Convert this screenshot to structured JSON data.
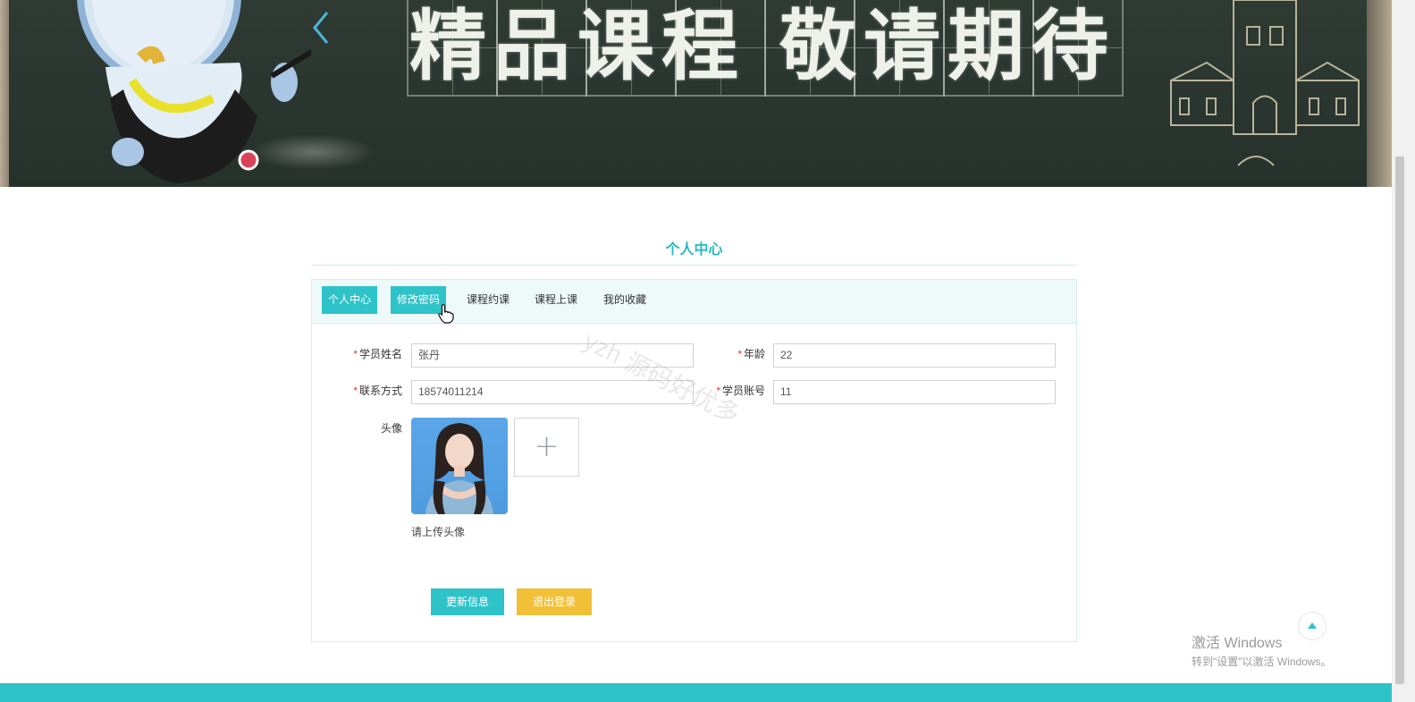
{
  "banner": {
    "title": "精品课程 敬请期待",
    "prev_arrow": "chevron-left-icon"
  },
  "section": {
    "title": "个人中心"
  },
  "tabs": [
    {
      "label": "个人中心",
      "state": "active"
    },
    {
      "label": "修改密码",
      "state": "hover"
    },
    {
      "label": "课程约课",
      "state": "normal"
    },
    {
      "label": "课程上课",
      "state": "normal"
    },
    {
      "label": "我的收藏",
      "state": "normal"
    }
  ],
  "form": {
    "name": {
      "label": "学员姓名",
      "value": "张丹",
      "required": true
    },
    "age": {
      "label": "年龄",
      "value": "22",
      "required": true
    },
    "phone": {
      "label": "联系方式",
      "value": "18574011214",
      "required": true
    },
    "account": {
      "label": "学员账号",
      "value": "11",
      "required": true
    },
    "avatar": {
      "label": "头像",
      "hint": "请上传头像",
      "upload_icon": "plus-icon"
    },
    "required_mark": "*"
  },
  "buttons": {
    "update": "更新信息",
    "logout": "退出登录"
  },
  "watermark": "yzh 源码好优多",
  "windows_activation": {
    "title": "激活 Windows",
    "subtitle": "转到\"设置\"以激活 Windows。"
  },
  "colors": {
    "accent": "#2ec3c9",
    "title": "#25b9c0",
    "logout": "#f2c037",
    "required": "#e4393c"
  }
}
